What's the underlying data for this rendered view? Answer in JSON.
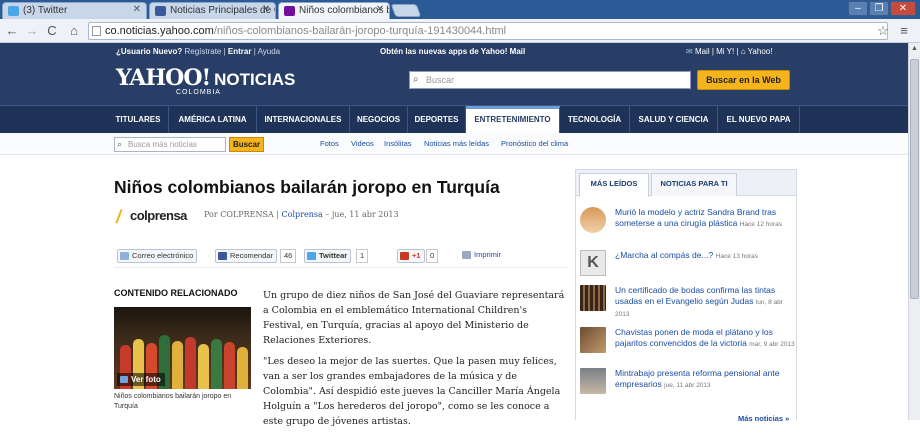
{
  "browser": {
    "tabs": [
      {
        "title": "(3) Twitter",
        "icon": "twitter-icon",
        "color": "#4aa8e8"
      },
      {
        "title": "Noticias Principales de Colom",
        "icon": "facebook-icon",
        "color": "#3b5998"
      },
      {
        "title": "Niños colombianos bailarán jo",
        "icon": "yahoo-icon",
        "color": "#720e9e"
      }
    ],
    "url_host": "co.noticias.yahoo.com",
    "url_path": "/niños-colombianos-bailarán-joropo-turquía-191430044.html"
  },
  "header": {
    "user_prefix": "¿Usuario Nuevo?",
    "register": "Regístrate",
    "login": "Entrar",
    "help": "Ayuda",
    "promo": "Obtén las nuevas apps de Yahoo! Mail",
    "mail": "Mail",
    "my_y": "Mi Y!",
    "home": "Yahoo!",
    "logo": "YAHOO!",
    "section": "NOTICIAS",
    "country": "COLOMBIA",
    "search_placeholder": "Buscar",
    "search_button": "Buscar en la Web"
  },
  "nav": {
    "items": [
      "TITULARES",
      "AMÉRICA LATINA",
      "INTERNACIONALES",
      "NEGOCIOS",
      "DEPORTES",
      "ENTRETENIMIENTO",
      "TECNOLOGÍA",
      "SALUD Y CIENCIA",
      "EL NUEVO PAPA"
    ],
    "active": "ENTRETENIMIENTO"
  },
  "subbar": {
    "search_placeholder": "Busca más noticias",
    "search_button": "Buscar",
    "links": [
      "Fotos",
      "Videos",
      "Insólitas",
      "Noticias más leídas",
      "Pronóstico del clima"
    ]
  },
  "article": {
    "headline": "Niños colombianos bailarán joropo en Turquía",
    "source_logo": "colprensa",
    "byline_prefix": "Por COLPRENSA | ",
    "byline_source": "Colprensa",
    "byline_date": " – jue, 11 abr 2013",
    "share": {
      "email": "Correo electrónico",
      "fb": "Recomendar",
      "fb_count": "46",
      "twitter": "Twittear",
      "twitter_count": "1",
      "gplus": "+1",
      "gplus_count": "0",
      "print": "Imprimir"
    },
    "related_heading": "CONTENIDO RELACIONADO",
    "related_photo_label": "Ver foto",
    "related_caption": "Niños colombianos bailarán joropo en Turquía",
    "paragraphs": [
      "Un grupo de diez niños de San José del Guaviare representará a Colombia en el emblemático International Children's Festival, en Turquía, gracias al apoyo del Ministerio de Relaciones Exteriores.",
      "\"Les deseo la mejor de las suertes. Que la pasen muy felices, van a ser los grandes embajadores de la música y de Colombia\". Así despidió este jueves la Canciller María Ángela Holguín a \"Los herederos del joropo\", como se les conoce a este grupo de jóvenes artistas."
    ]
  },
  "sidebar": {
    "tabs": [
      "MÁS LEÍDOS",
      "NOTICIAS PARA TI"
    ],
    "items": [
      {
        "title": "Murió la modelo y actriz Sandra Brand tras someterse a una cirugía plástica",
        "time": "Hace 12 horas"
      },
      {
        "title": "¿Marcha al compás de...?",
        "time": "Hace 13 horas"
      },
      {
        "title": "Un certificado de bodas confirma las tintas usadas en el Evangelio según Judas",
        "time": "lun, 8 abr 2013"
      },
      {
        "title": "Chavistas ponen de moda el plátano y los pajaritos convencidos de la victoria",
        "time": "mar, 9 abr 2013"
      },
      {
        "title": "Mintrabajo presenta reforma pensional ante empresarios",
        "time": "jue, 11 abr 2013"
      }
    ],
    "more": "Más noticias »"
  }
}
